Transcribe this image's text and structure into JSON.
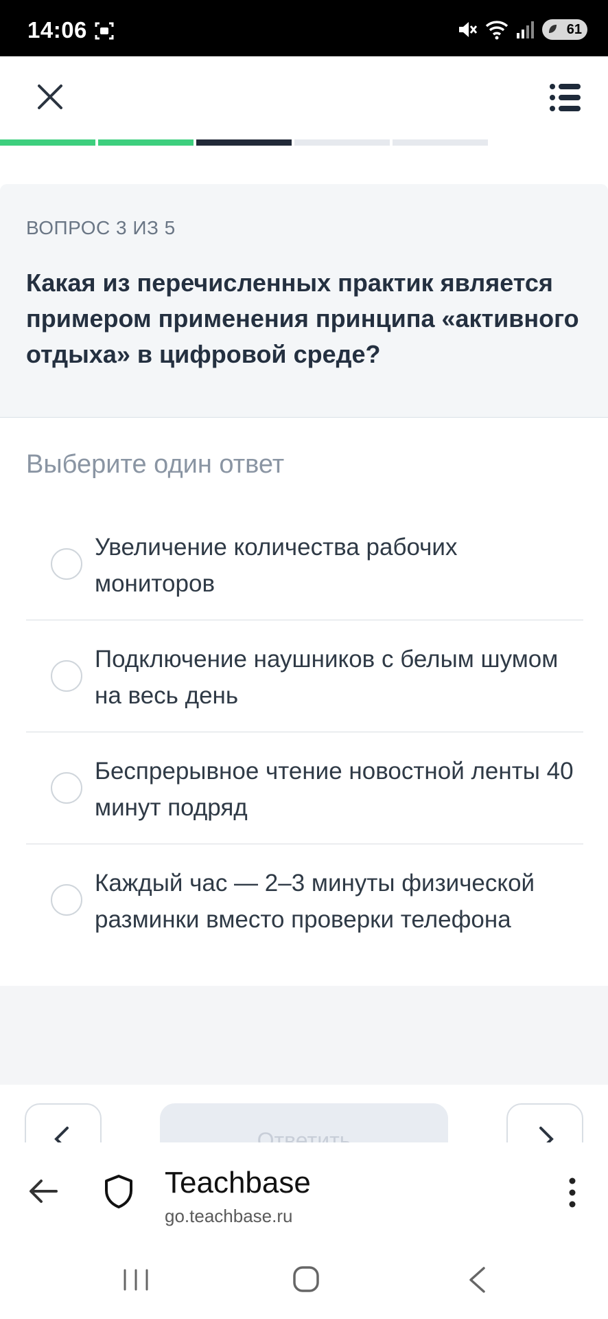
{
  "status_bar": {
    "time": "14:06",
    "battery": "61"
  },
  "quiz": {
    "progress_segments": [
      "done",
      "done",
      "current",
      "todo",
      "todo"
    ],
    "counter": "ВОПРОС 3 ИЗ 5",
    "question": "Какая из перечисленных практик является примером применения принципа «активного отдыха» в цифровой среде?",
    "hint": "Выберите один ответ",
    "answers": [
      {
        "label": "Увеличение количества рабочих мониторов"
      },
      {
        "label": "Подключение наушников с белым шумом на весь день"
      },
      {
        "label": "Беспрерывное чтение новостной ленты 40 минут подряд"
      },
      {
        "label": "Каждый час — 2–3 минуты физической разминки вместо проверки телефона"
      }
    ],
    "submit_label": "Ответить"
  },
  "browser": {
    "site_title": "Teachbase",
    "site_url": "go.teachbase.ru"
  },
  "colors": {
    "progress_done": "#3ecf7e",
    "progress_current": "#222a38",
    "progress_todo": "#e6e9ee"
  }
}
